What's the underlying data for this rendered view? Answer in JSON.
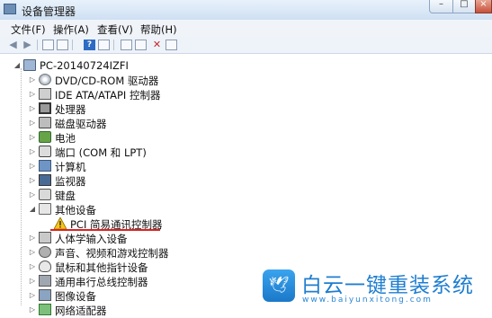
{
  "window": {
    "title": "设备管理器"
  },
  "menu": [
    "文件(F)",
    "操作(A)",
    "查看(V)",
    "帮助(H)"
  ],
  "tree": {
    "root": "PC-20140724IZFI",
    "items": [
      "DVD/CD-ROM 驱动器",
      "IDE ATA/ATAPI 控制器",
      "处理器",
      "磁盘驱动器",
      "电池",
      "端口 (COM 和 LPT)",
      "计算机",
      "监视器",
      "键盘",
      "其他设备",
      "PCI 简易通讯控制器",
      "人体学输入设备",
      "声音、视频和游戏控制器",
      "鼠标和其他指针设备",
      "通用串行总线控制器",
      "图像设备",
      "网络适配器"
    ]
  },
  "brand": {
    "name": "白云一键重装系统",
    "url": "www.baiyunxitong.com"
  },
  "colors": {
    "highlight_line": "#dd2222",
    "brand_blue": "#1f7ed0"
  }
}
